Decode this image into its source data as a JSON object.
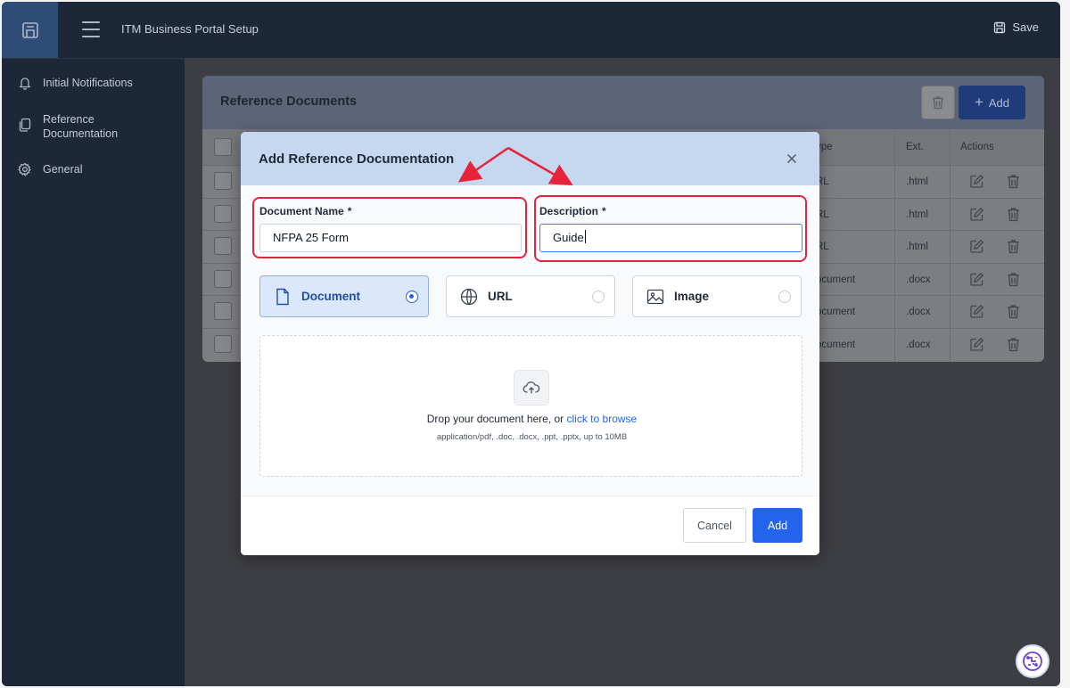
{
  "app": {
    "title": "ITM Business Portal Setup",
    "save_label": "Save"
  },
  "sidebar": {
    "items": [
      {
        "label": "Initial Notifications",
        "icon": "bell-icon"
      },
      {
        "label": "Reference\nDocumentation",
        "icon": "documents-icon"
      },
      {
        "label": "General",
        "icon": "gear-icon"
      }
    ]
  },
  "card": {
    "title": "Reference Documents",
    "add_label": "Add",
    "columns": {
      "type": "ype",
      "ext": "Ext.",
      "actions": "Actions"
    },
    "rows": [
      {
        "type": "RL",
        "ext": ".html"
      },
      {
        "type": "RL",
        "ext": ".html"
      },
      {
        "type": "RL",
        "ext": ".html"
      },
      {
        "type": "ocument",
        "ext": ".docx"
      },
      {
        "type": "ocument",
        "ext": ".docx"
      },
      {
        "type": "ocument",
        "ext": ".docx"
      }
    ]
  },
  "modal": {
    "title": "Add Reference Documentation",
    "doc_name_label": "Document Name",
    "doc_name_value": "NFPA 25 Form",
    "description_label": "Description",
    "description_value": "Guide",
    "required_mark": "*",
    "options": [
      {
        "label": "Document",
        "selected": true,
        "icon": "document-icon"
      },
      {
        "label": "URL",
        "selected": false,
        "icon": "globe-icon"
      },
      {
        "label": "Image",
        "selected": false,
        "icon": "image-icon"
      }
    ],
    "dropzone": {
      "text": "Drop your document here, or ",
      "link": "click to browse",
      "hint": "application/pdf, .doc, .docx, .ppt, .pptx, up to 10MB"
    },
    "cancel_label": "Cancel",
    "add_label": "Add"
  },
  "colors": {
    "sidebar_bg": "#1c2738",
    "primary": "#2463eb",
    "highlight": "#e5243b"
  }
}
